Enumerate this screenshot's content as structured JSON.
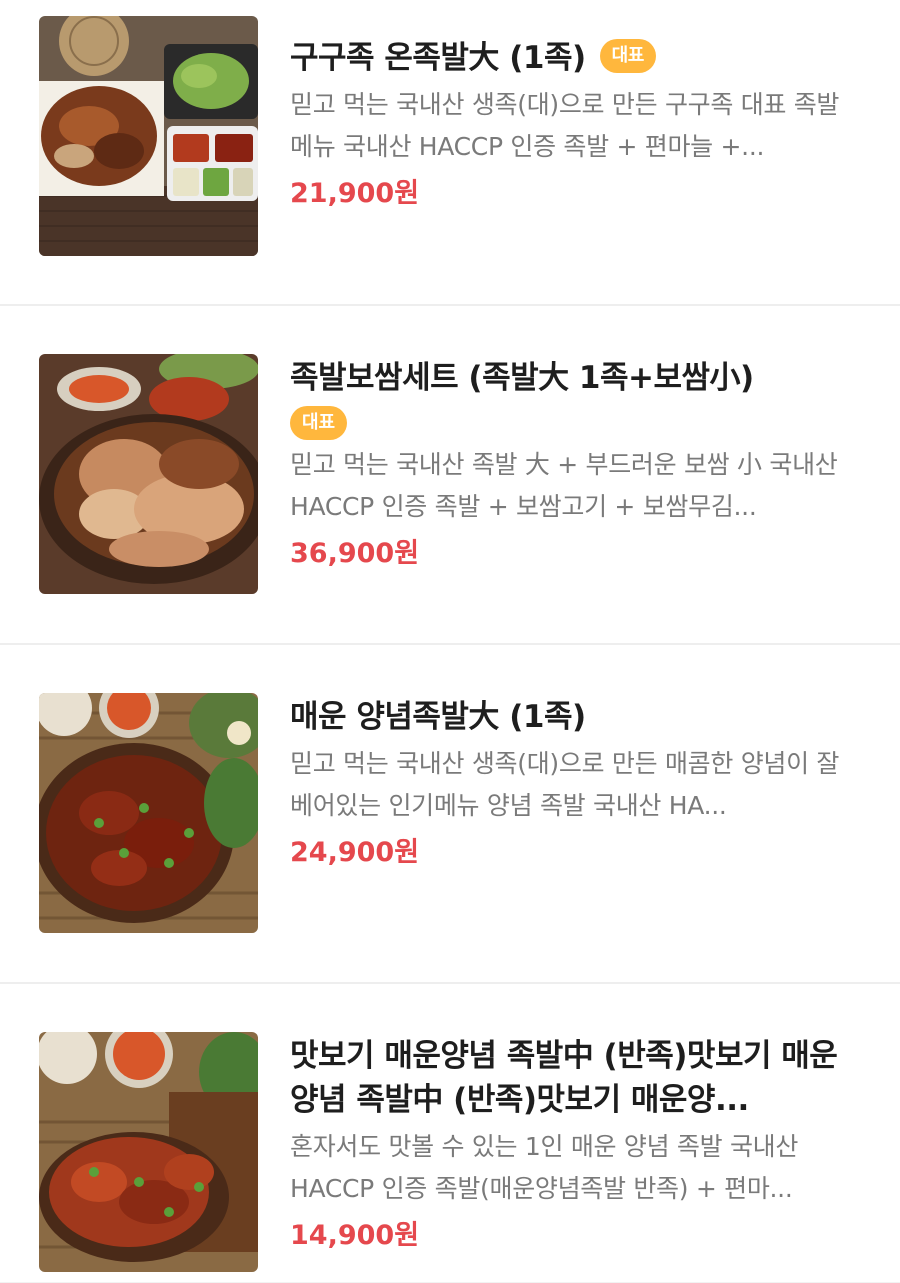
{
  "colors": {
    "badge": "#ffb73d",
    "price": "#e5484d",
    "desc": "#7a7a7a"
  },
  "menu_items": [
    {
      "title": "구구족 온족발大 (1족)",
      "badge": "대표",
      "description": "믿고 먹는 국내산 생족(대)으로 만든 구구족 대표 족발 메뉴 국내산 HACCP 인증 족발 + 편마늘 +...",
      "price": "21,900원",
      "image": "jokbal-platter-photo"
    },
    {
      "title": "족발보쌈세트 (족발大 1족+보쌈小)",
      "badge": "대표",
      "description": "믿고 먹는 국내산 족발 大 + 부드러운 보쌈 小 국내산 HACCP 인증 족발 + 보쌈고기 + 보쌈무김...",
      "price": "36,900원",
      "image": "jokbal-bossam-set-photo"
    },
    {
      "title": "매운 양념족발大 (1족)",
      "description": "믿고 먹는 국내산 생족(대)으로 만든 매콤한 양념이 잘 베어있는 인기메뉴 양념 족발 국내산 HA...",
      "price": "24,900원",
      "image": "spicy-jokbal-photo"
    },
    {
      "title": "맛보기 매운양념 족발中 (반족)맛보기 매운양념 족발中 (반족)맛보기 매운양...",
      "description": "혼자서도 맛볼 수 있는 1인 매운 양념 족발 국내산 HACCP 인증 족발(매운양념족발 반족) + 편마...",
      "price": "14,900원",
      "image": "spicy-jokbal-half-photo"
    }
  ]
}
